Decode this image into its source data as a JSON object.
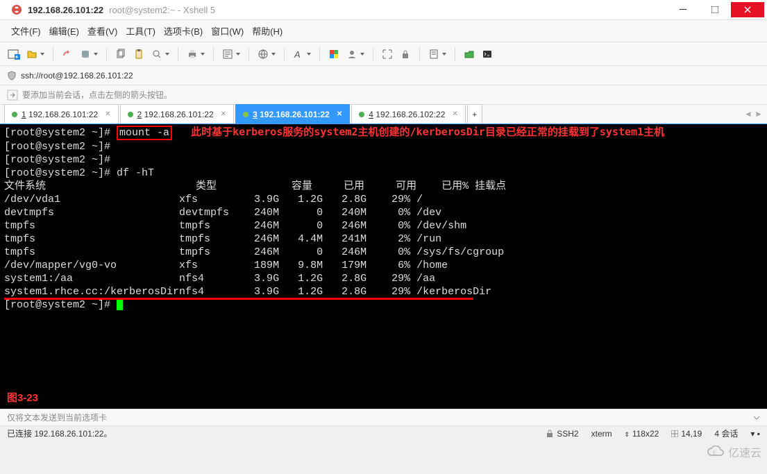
{
  "window": {
    "title": "192.168.26.101:22",
    "subtitle": "root@system2:~ - Xshell 5"
  },
  "menu": {
    "items": [
      "文件(F)",
      "编辑(E)",
      "查看(V)",
      "工具(T)",
      "选项卡(B)",
      "窗口(W)",
      "帮助(H)"
    ]
  },
  "address": {
    "url": "ssh://root@192.168.26.101:22"
  },
  "hint": {
    "text": "要添加当前会话，点击左侧的箭头按钮。"
  },
  "tabs": {
    "items": [
      {
        "prefix": "1",
        "label": "192.168.26.101:22",
        "active": false
      },
      {
        "prefix": "2",
        "label": "192.168.26.101:22",
        "active": false
      },
      {
        "prefix": "3",
        "label": "192.168.26.101:22",
        "active": true
      },
      {
        "prefix": "4",
        "label": "192.168.26.102:22",
        "active": false
      }
    ],
    "add": "+"
  },
  "terminal": {
    "prompt": "[root@system2 ~]#",
    "mount_cmd": "mount -a",
    "annotation": "此时基于kerberos服务的system2主机创建的/kerberosDir目录已经正常的挂载到了system1主机",
    "df_cmd": "df -hT",
    "headers": {
      "fs": "文件系统",
      "type": "类型",
      "size": "容量",
      "used": "已用",
      "avail": "可用",
      "usep": "已用%",
      "mount": "挂载点"
    },
    "rows": [
      {
        "fs": "/dev/vda1",
        "type": "xfs",
        "size": "3.9G",
        "used": "1.2G",
        "avail": "2.8G",
        "usep": "29%",
        "mount": "/"
      },
      {
        "fs": "devtmpfs",
        "type": "devtmpfs",
        "size": "240M",
        "used": "0",
        "avail": "240M",
        "usep": "0%",
        "mount": "/dev"
      },
      {
        "fs": "tmpfs",
        "type": "tmpfs",
        "size": "246M",
        "used": "0",
        "avail": "246M",
        "usep": "0%",
        "mount": "/dev/shm"
      },
      {
        "fs": "tmpfs",
        "type": "tmpfs",
        "size": "246M",
        "used": "4.4M",
        "avail": "241M",
        "usep": "2%",
        "mount": "/run"
      },
      {
        "fs": "tmpfs",
        "type": "tmpfs",
        "size": "246M",
        "used": "0",
        "avail": "246M",
        "usep": "0%",
        "mount": "/sys/fs/cgroup"
      },
      {
        "fs": "/dev/mapper/vg0-vo",
        "type": "xfs",
        "size": "189M",
        "used": "9.8M",
        "avail": "179M",
        "usep": "6%",
        "mount": "/home"
      },
      {
        "fs": "system1:/aa",
        "type": "nfs4",
        "size": "3.9G",
        "used": "1.2G",
        "avail": "2.8G",
        "usep": "29%",
        "mount": "/aa"
      },
      {
        "fs": "system1.rhce.cc:/kerberosDir",
        "type": "nfs4",
        "size": "3.9G",
        "used": "1.2G",
        "avail": "2.8G",
        "usep": "29%",
        "mount": "/kerberosDir"
      }
    ],
    "fig_label": "图3-23"
  },
  "bottom": {
    "hint": "仅将文本发送到当前选项卡"
  },
  "status": {
    "connected": "已连接 192.168.26.101:22。",
    "ssh": "SSH2",
    "term": "xterm",
    "size": "118x22",
    "pos": "14,19",
    "sessions": "4 会话"
  },
  "watermark": "亿速云"
}
